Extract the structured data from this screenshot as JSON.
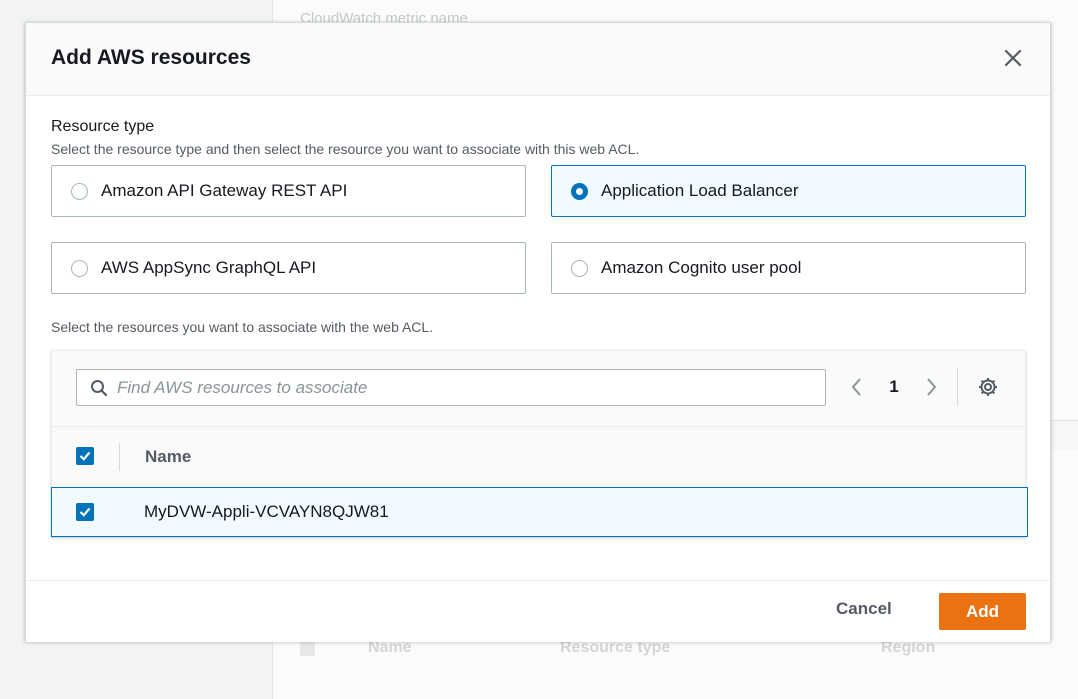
{
  "background": {
    "metric_label": "CloudWatch metric name",
    "table_headers": [
      "Name",
      "Resource type",
      "Region"
    ]
  },
  "modal": {
    "title": "Add AWS resources",
    "resource_type_label": "Resource type",
    "resource_type_description": "Select the resource type and then select the resource you want to associate with this web ACL.",
    "resource_types": [
      {
        "label": "Amazon API Gateway REST API",
        "selected": false
      },
      {
        "label": "Application Load Balancer",
        "selected": true
      },
      {
        "label": "AWS AppSync GraphQL API",
        "selected": false
      },
      {
        "label": "Amazon Cognito user pool",
        "selected": false
      }
    ],
    "resources_description": "Select the resources you want to associate with the web ACL.",
    "search": {
      "placeholder": "Find AWS resources to associate",
      "value": ""
    },
    "pagination": {
      "current_page": "1"
    },
    "table": {
      "column_name": "Name",
      "rows": [
        {
          "name": "MyDVW-Appli-VCVAYN8QJW81",
          "checked": true
        }
      ]
    },
    "footer": {
      "cancel_label": "Cancel",
      "add_label": "Add"
    }
  },
  "colors": {
    "accent": "#0073bb",
    "primary_button": "#ec7211",
    "selected_bg": "#f1faff"
  }
}
